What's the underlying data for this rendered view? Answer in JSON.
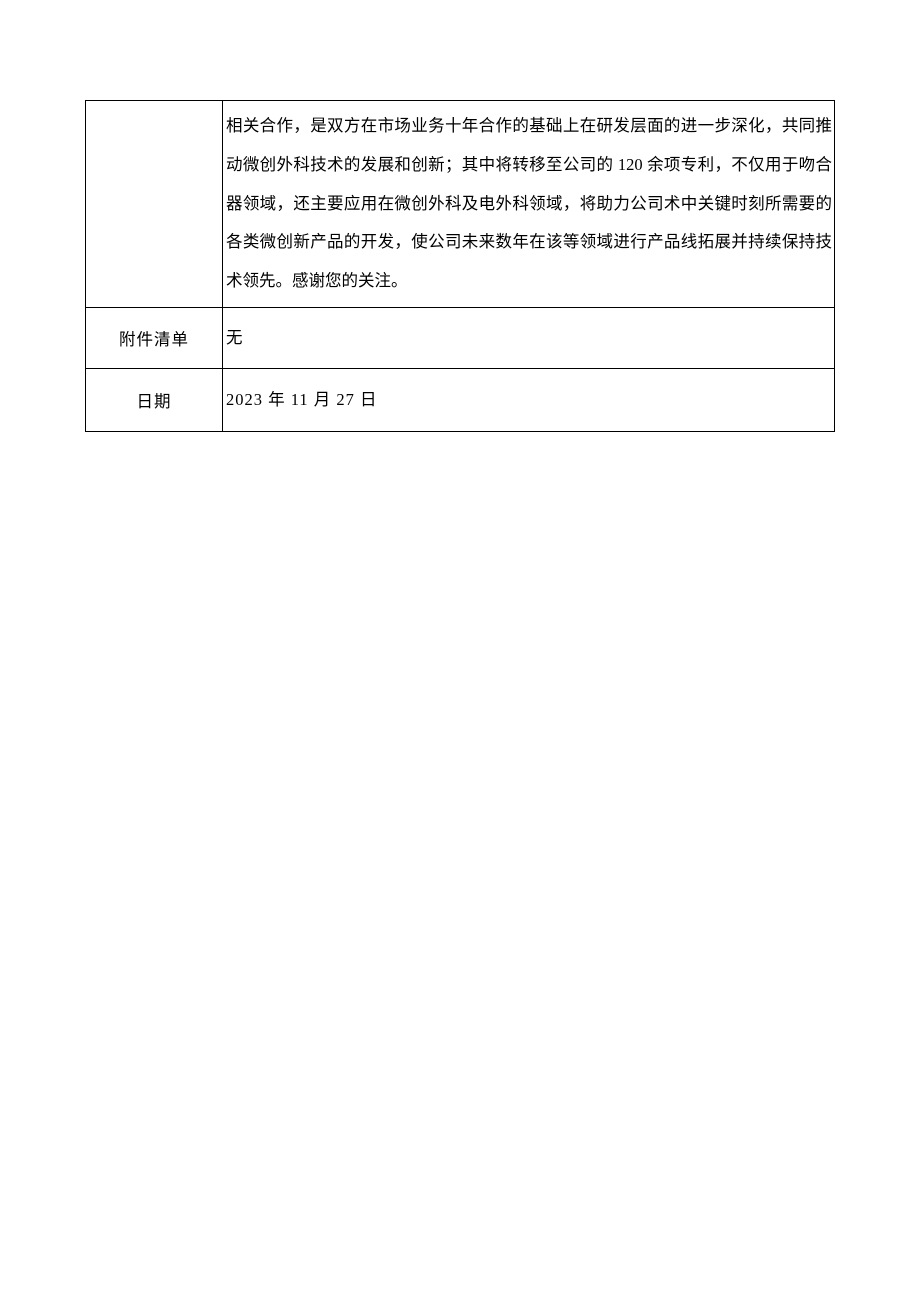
{
  "rows": [
    {
      "label": "",
      "content": "相关合作，是双方在市场业务十年合作的基础上在研发层面的进一步深化，共同推动微创外科技术的发展和创新；其中将转移至公司的 120 余项专利，不仅用于吻合器领域，还主要应用在微创外科及电外科领域，将助力公司术中关键时刻所需要的各类微创新产品的开发，使公司未来数年在该等领域进行产品线拓展并持续保持技术领先。感谢您的关注。"
    },
    {
      "label": "附件清单",
      "content": "无"
    },
    {
      "label": "日期",
      "content": "2023 年 11 月 27 日"
    }
  ]
}
